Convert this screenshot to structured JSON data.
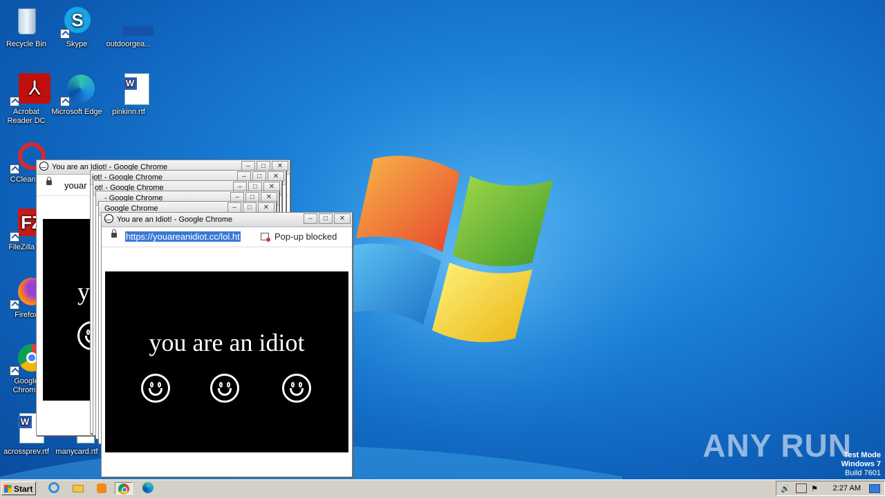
{
  "desktop": {
    "icons": [
      {
        "label": "Recycle Bin"
      },
      {
        "label": "Skype"
      },
      {
        "label": "outdoorgea..."
      },
      {
        "label": "Acrobat Reader DC"
      },
      {
        "label": "Microsoft Edge"
      },
      {
        "label": "pinkinn.rtf"
      },
      {
        "label": "CCleaner"
      },
      {
        "label": "FileZilla Cl"
      },
      {
        "label": "Firefox"
      },
      {
        "label": "Google Chrome"
      },
      {
        "label": "acrossprev.rtf"
      },
      {
        "label": "manycard.rtf"
      }
    ]
  },
  "windows": {
    "back_title": "You are an Idiot! - Google Chrome",
    "back_url": "youar",
    "stack_titles": [
      "iot! - Google Chrome",
      "ot! - Google Chrome",
      "- Google Chrome",
      "Google Chrome"
    ],
    "front_title": "You are an Idiot! - Google Chrome",
    "front_url": "https://youareanidiot.cc/lol.ht",
    "popup_blocked": "Pop-up blocked",
    "content_text": "you are an idiot",
    "back_content_text": "y"
  },
  "taskbar": {
    "start_label": "Start",
    "clock": "2:27 AM"
  },
  "watermark": {
    "line1": "Test Mode",
    "line2": "Windows 7",
    "line3": "Build 7601",
    "brand": "ANY RUN"
  },
  "colors": {
    "desktop_blue": "#1a7fd6",
    "url_highlight": "#3a78d6",
    "content_bg": "#000000"
  }
}
